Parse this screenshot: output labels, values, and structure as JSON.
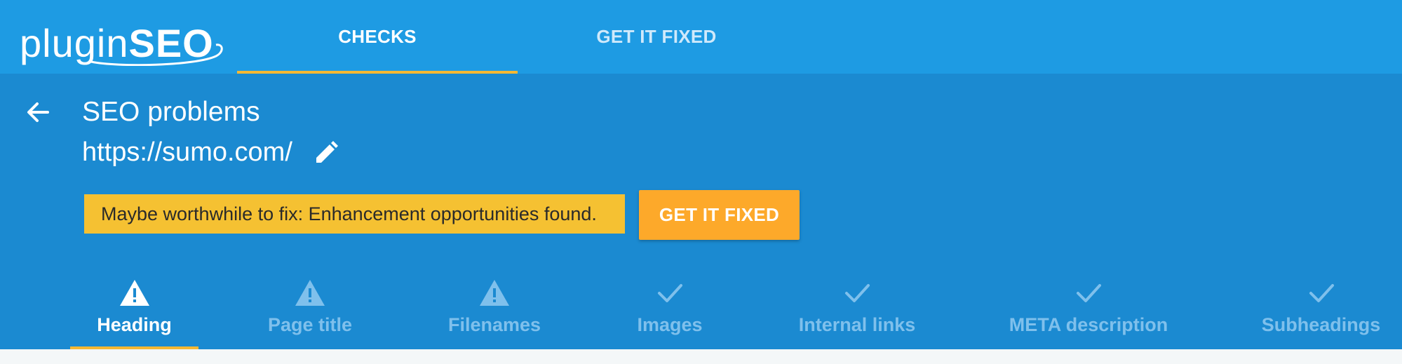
{
  "header": {
    "logo_light": "plugin",
    "logo_bold": "SEO",
    "tabs": [
      {
        "label": "CHECKS",
        "active": true
      },
      {
        "label": "GET IT FIXED",
        "active": false
      }
    ]
  },
  "page": {
    "title": "SEO problems",
    "url": "https://sumo.com/",
    "notice": "Maybe worthwhile to fix: Enhancement opportunities found.",
    "fix_button": "GET IT FIXED"
  },
  "checks": [
    {
      "label": "Heading",
      "icon": "warning-icon",
      "active": true
    },
    {
      "label": "Page title",
      "icon": "warning-icon",
      "active": false
    },
    {
      "label": "Filenames",
      "icon": "warning-icon",
      "active": false
    },
    {
      "label": "Images",
      "icon": "check-icon",
      "active": false
    },
    {
      "label": "Internal links",
      "icon": "check-icon",
      "active": false
    },
    {
      "label": "META description",
      "icon": "check-icon",
      "active": false
    },
    {
      "label": "Subheadings",
      "icon": "check-icon",
      "active": false
    }
  ],
  "colors": {
    "topbar": "#1e9be3",
    "panel": "#1b8ad1",
    "notice": "#f5c132",
    "button": "#fda92a",
    "accent_underline": "#f5b833"
  }
}
